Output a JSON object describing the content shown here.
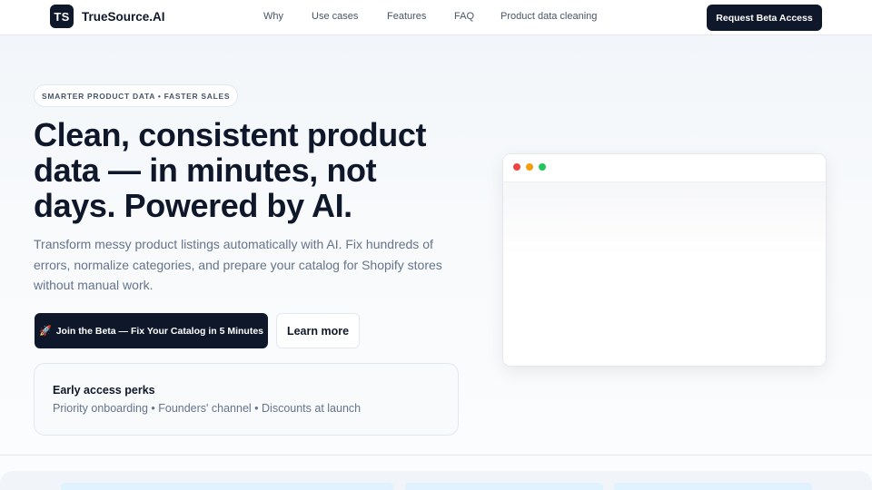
{
  "brand": {
    "logo_text": "TS",
    "name": "TrueSource.AI"
  },
  "nav": {
    "links": [
      "Why",
      "Use cases",
      "Features",
      "FAQ",
      "Product data cleaning"
    ],
    "cta": "Request Beta Access"
  },
  "hero": {
    "badge": "SMARTER PRODUCT DATA • FASTER SALES",
    "title_line1": "Clean, consistent product",
    "title_line2": "data — in minutes, not",
    "title_line3": "days. Powered by AI.",
    "subtitle": "Transform messy product listings automatically with AI. Fix hundreds of errors, normalize categories, and prepare your catalog for Shopify stores without manual work.",
    "primary_icon": "🚀",
    "primary_button": "Join the Beta — Fix Your Catalog in 5 Minutes",
    "secondary_button": "Learn more"
  },
  "perks": {
    "title": "Early access perks",
    "list": "Priority onboarding • Founders' channel • Discounts at launch"
  },
  "browser_mock": {
    "dot_colors": [
      "#ef4444",
      "#f59e0b",
      "#22c55e"
    ]
  },
  "colors": {
    "primary": "#0f172a",
    "muted_text": "#64748b",
    "border": "#e2e8f0",
    "card_tint": "#e0f2fe"
  }
}
